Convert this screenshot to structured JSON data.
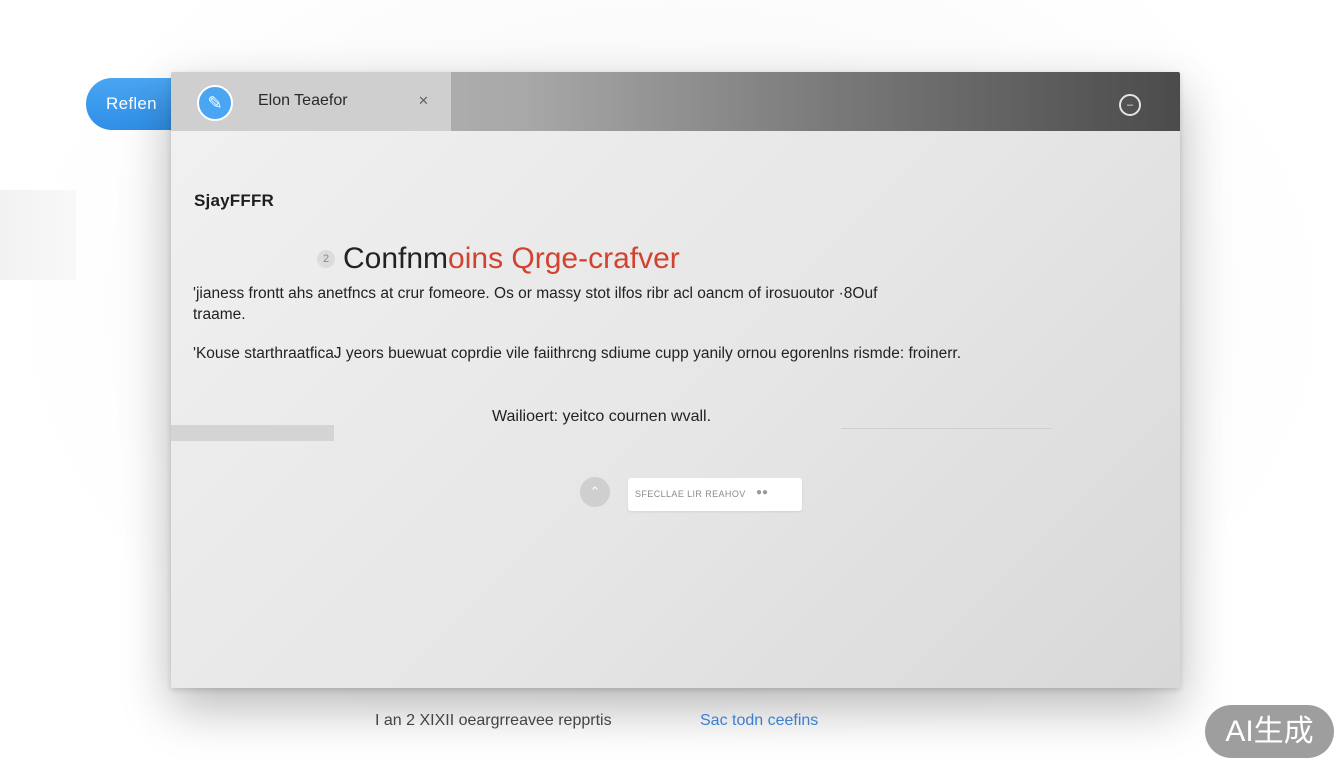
{
  "side_tab": {
    "label": "Reflen"
  },
  "window": {
    "tab": {
      "avatar_glyph": "✎",
      "title": "Elon Teaefor",
      "close_glyph": "✕"
    },
    "titlebar_icon": "minimize-circle-icon",
    "brand": "SjayFFFR",
    "heading": {
      "number": "2",
      "text_dark": "Confnm",
      "text_accent": "oins Qrge-crafver"
    },
    "paragraph1": "'jianess frontt ahs anetfncs at crur fomeore. Os or massy stot ilfos ribr acl oancm of irosuoutor ·8Ouf traame.",
    "paragraph2": "'Kouse starthraatficaJ yeors buewuat coprdie vile faiithrcng sdiume cupp yanily ornou egorenlns rismde: froinerr.",
    "status_text": "Wailioert: yeitco cournen wvall.",
    "progress": 0.0,
    "action": {
      "button_glyph": "⌃",
      "field_text": "SFECLLAE LIR REAHOV",
      "field_dots": "●●"
    }
  },
  "footer": {
    "left_text": "I an 2  XIXII oeargrreavee repprtis",
    "link_text": "Sac todn ceefins"
  },
  "badge": {
    "text": "AI生成"
  },
  "colors": {
    "accent_blue": "#4aa6f3",
    "heading_red": "#d2432f",
    "link_blue": "#3b7fd0"
  }
}
